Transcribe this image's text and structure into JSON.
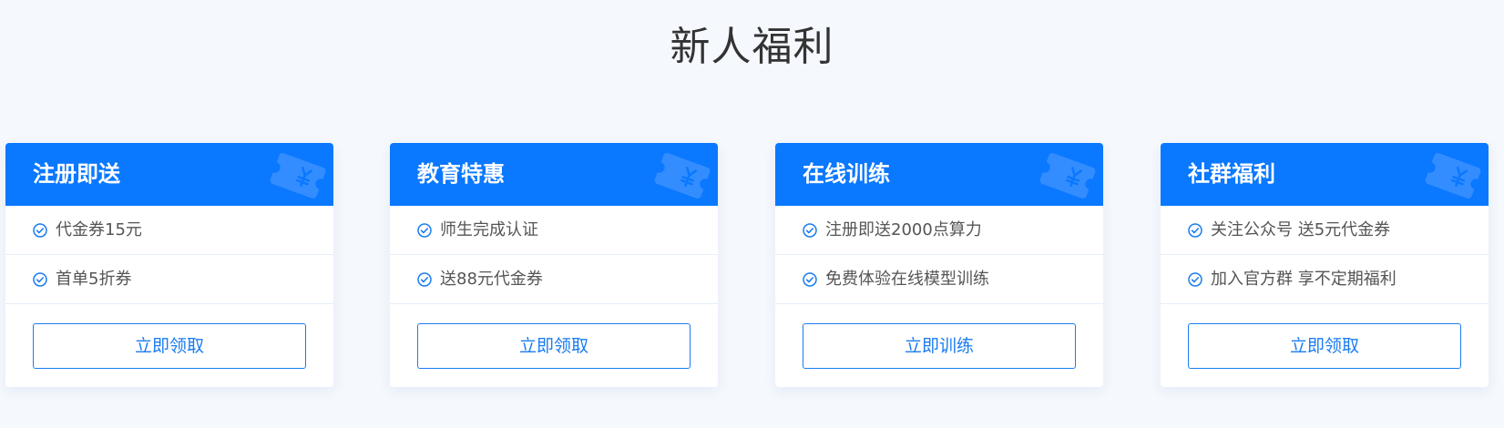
{
  "section": {
    "title": "新人福利"
  },
  "colors": {
    "accent": "#0a78ff",
    "button_border": "#1a7cf0",
    "page_background": "#f5f8fd"
  },
  "icons": {
    "header_decoration": "ticket-yen-icon",
    "item_marker": "check-circle-icon"
  },
  "cards": [
    {
      "title": "注册即送",
      "items": [
        "代金券15元",
        "首单5折券"
      ],
      "button": "立即领取"
    },
    {
      "title": "教育特惠",
      "items": [
        "师生完成认证",
        "送88元代金券"
      ],
      "button": "立即领取"
    },
    {
      "title": "在线训练",
      "items": [
        "注册即送2000点算力",
        "免费体验在线模型训练"
      ],
      "button": "立即训练"
    },
    {
      "title": "社群福利",
      "items": [
        "关注公众号 送5元代金券",
        "加入官方群 享不定期福利"
      ],
      "button": "立即领取"
    }
  ]
}
